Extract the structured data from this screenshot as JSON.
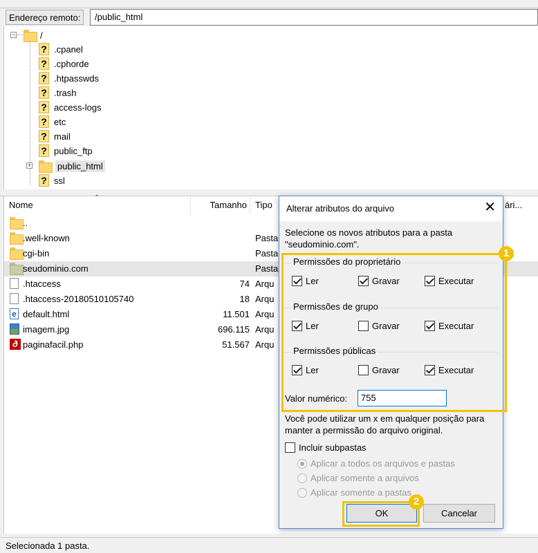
{
  "address": {
    "label": "Endereço remoto:",
    "value": "/public_html"
  },
  "tree": {
    "root": "/",
    "items": [
      ".cpanel",
      ".cphorde",
      ".htpasswds",
      ".trash",
      "access-logs",
      "etc",
      "mail",
      "public_ftp",
      "public_html",
      "ssl"
    ],
    "selected": "public_html"
  },
  "list": {
    "headers": {
      "name": "Nome",
      "size": "Tamanho",
      "type": "Tipo",
      "extra": "ári..."
    },
    "rows": [
      {
        "name": "..",
        "size": "",
        "type": "",
        "icon": "folder-icon"
      },
      {
        "name": ".well-known",
        "size": "",
        "type": "Pasta",
        "icon": "folder-icon"
      },
      {
        "name": "cgi-bin",
        "size": "",
        "type": "Pasta",
        "icon": "folder-icon"
      },
      {
        "name": "seudominio.com",
        "size": "",
        "type": "Pasta",
        "icon": "folder-icon"
      },
      {
        "name": ".htaccess",
        "size": "74",
        "type": "Arqu",
        "icon": "document-icon"
      },
      {
        "name": ".htaccess-20180510105740",
        "size": "18",
        "type": "Arqu",
        "icon": "document-icon"
      },
      {
        "name": "default.html",
        "size": "11.501",
        "type": "Arqu",
        "icon": "html-file-icon"
      },
      {
        "name": "imagem.jpg",
        "size": "696.115",
        "type": "Arqu",
        "icon": "image-file-icon"
      },
      {
        "name": "paginafacil.php",
        "size": "51.567",
        "type": "Arqu",
        "icon": "php-file-icon"
      }
    ]
  },
  "status": {
    "text": "Selecionada 1 pasta."
  },
  "dialog": {
    "title": "Alterar atributos do arquivo",
    "intro_line1": "Selecione os novos atributos para a pasta",
    "intro_line2": "\"seudominio.com\".",
    "groups": [
      {
        "title": "Permissões do proprietário",
        "read": {
          "label": "Ler",
          "checked": true
        },
        "write": {
          "label": "Gravar",
          "checked": true
        },
        "exec": {
          "label": "Executar",
          "checked": true
        }
      },
      {
        "title": "Permissões de grupo",
        "read": {
          "label": "Ler",
          "checked": true
        },
        "write": {
          "label": "Gravar",
          "checked": false
        },
        "exec": {
          "label": "Executar",
          "checked": true
        }
      },
      {
        "title": "Permissões públicas",
        "read": {
          "label": "Ler",
          "checked": true
        },
        "write": {
          "label": "Gravar",
          "checked": false
        },
        "exec": {
          "label": "Executar",
          "checked": true
        }
      }
    ],
    "numeric_label": "Valor numérico:",
    "numeric_value": "755",
    "hint_line1": "Você pode utilizar um x em qualquer posição para",
    "hint_line2": "manter a permissão do arquivo original.",
    "recurse_label": "Incluir subpastas",
    "radio_all": "Aplicar a todos os arquivos e pastas",
    "radio_files": "Aplicar somente a arquivos",
    "radio_dirs": "Aplicar somente a pastas",
    "ok": "OK",
    "cancel": "Cancelar"
  },
  "callouts": {
    "one": "1",
    "two": "2",
    "color": "#f2c200"
  }
}
